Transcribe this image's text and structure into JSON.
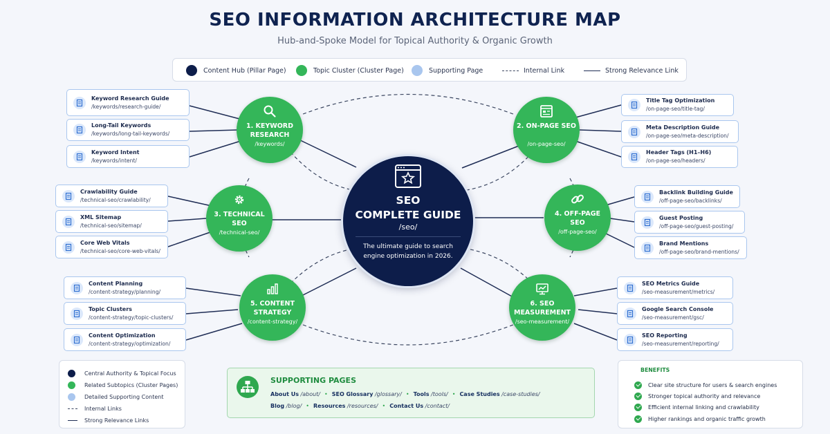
{
  "title": "SEO INFORMATION ARCHITECTURE MAP",
  "subtitle": "Hub-and-Spoke Model for Topical Authority & Organic Growth",
  "legend": {
    "content_hub": "Content Hub (Pillar Page)",
    "topic_cluster": "Topic Cluster (Cluster Page)",
    "supporting_page": "Supporting Page",
    "internal_link": "Internal Link",
    "strong_link": "Strong Relevance Link"
  },
  "colors": {
    "navy": "#0d1d4a",
    "green": "#34b659",
    "light_blue": "#a9c6ee",
    "accent_green": "#1f8c3f"
  },
  "center": {
    "title_line1": "SEO",
    "title_line2": "COMPLETE GUIDE",
    "slug": "/seo/",
    "description": "The ultimate guide to search engine optimization in 2026.",
    "icon": "browser-star-icon"
  },
  "hubs": [
    {
      "title": "1. KEYWORD RESEARCH",
      "slug": "/keywords/",
      "icon": "search-icon",
      "subs": [
        {
          "label": "Keyword Research Guide",
          "slug": "/keywords/research-guide/"
        },
        {
          "label": "Long-Tail Keywords",
          "slug": "/keywords/long-tail-keywords/"
        },
        {
          "label": "Keyword Intent",
          "slug": "/keywords/intent/"
        }
      ]
    },
    {
      "title": "2. ON-PAGE SEO",
      "slug": "/on-page-seo/",
      "icon": "page-layout-icon",
      "subs": [
        {
          "label": "Title Tag Optimization",
          "slug": "/on-page-seo/title-tag/"
        },
        {
          "label": "Meta Description Guide",
          "slug": "/on-page-seo/meta-description/"
        },
        {
          "label": "Header Tags (H1–H6)",
          "slug": "/on-page-seo/headers/"
        }
      ]
    },
    {
      "title": "3. TECHNICAL SEO",
      "slug": "/technical-seo/",
      "icon": "gear-icon",
      "subs": [
        {
          "label": "Crawlability Guide",
          "slug": "/technical-seo/crawlability/"
        },
        {
          "label": "XML Sitemap",
          "slug": "/technical-seo/sitemap/"
        },
        {
          "label": "Core Web Vitals",
          "slug": "/technical-seo/core-web-vitals/"
        }
      ]
    },
    {
      "title": "4. OFF-PAGE SEO",
      "slug": "/off-page-seo/",
      "icon": "link-icon",
      "subs": [
        {
          "label": "Backlink Building Guide",
          "slug": "/off-page-seo/backlinks/"
        },
        {
          "label": "Guest Posting",
          "slug": "/off-page-seo/guest-posting/"
        },
        {
          "label": "Brand Mentions",
          "slug": "/off-page-seo/brand-mentions/"
        }
      ]
    },
    {
      "title": "5. CONTENT STRATEGY",
      "slug": "/content-strategy/",
      "icon": "bar-chart-icon",
      "subs": [
        {
          "label": "Content Planning",
          "slug": "/content-strategy/planning/"
        },
        {
          "label": "Topic Clusters",
          "slug": "/content-strategy/topic-clusters/"
        },
        {
          "label": "Content Optimization",
          "slug": "/content-strategy/optimization/"
        }
      ]
    },
    {
      "title": "6. SEO MEASUREMENT",
      "slug": "/seo-measurement/",
      "icon": "monitor-chart-icon",
      "subs": [
        {
          "label": "SEO Metrics Guide",
          "slug": "/seo-measurement/metrics/"
        },
        {
          "label": "Google Search Console",
          "slug": "/seo-measurement/gsc/"
        },
        {
          "label": "SEO Reporting",
          "slug": "/seo-measurement/reporting/"
        }
      ]
    }
  ],
  "key": {
    "central": "Central Authority & Topical Focus",
    "related": "Related Subtopics (Cluster Pages)",
    "detailed": "Detailed Supporting Content",
    "internal": "Internal Links",
    "strong": "Strong Relevance Links"
  },
  "supporting": {
    "title": "SUPPORTING PAGES",
    "row1": [
      {
        "label": "About Us",
        "slug": "/about/"
      },
      {
        "label": "SEO Glossary",
        "slug": "/glossary/"
      },
      {
        "label": "Tools",
        "slug": "/tools/"
      },
      {
        "label": "Case Studies",
        "slug": "/case-studies/"
      }
    ],
    "row2": [
      {
        "label": "Blog",
        "slug": "/blog/"
      },
      {
        "label": "Resources",
        "slug": "/resources/"
      },
      {
        "label": "Contact Us",
        "slug": "/contact/"
      }
    ]
  },
  "benefits": {
    "title": "BENEFITS",
    "items": [
      "Clear site structure for users & search engines",
      "Stronger topical authority and relevance",
      "Efficient internal linking and crawlability",
      "Higher rankings and organic traffic growth"
    ]
  }
}
